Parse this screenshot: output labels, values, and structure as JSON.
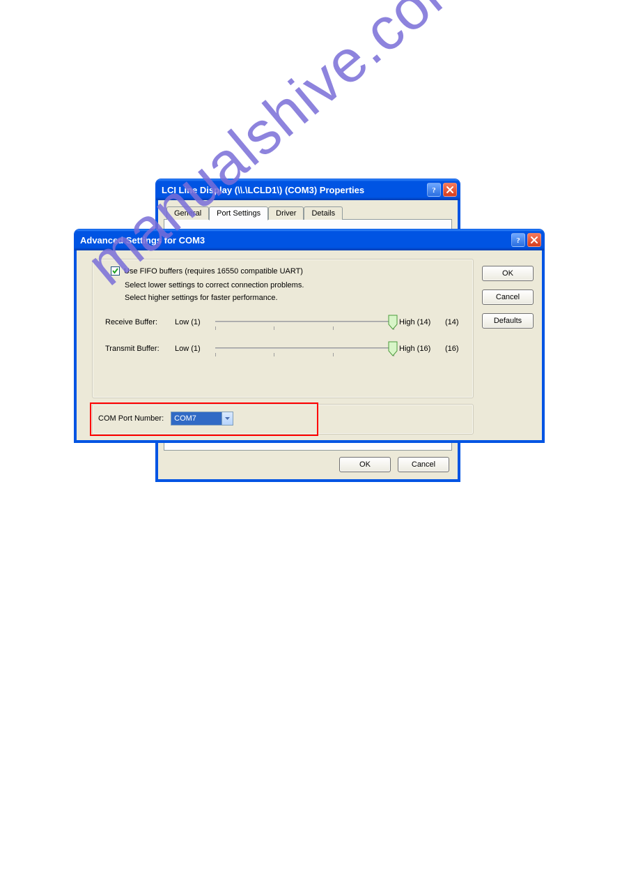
{
  "watermark": "manualshive.com",
  "parent": {
    "title": "LCI Line Display (\\\\.\\LCLD1\\) (COM3) Properties",
    "tabs": {
      "items": [
        {
          "label": "General"
        },
        {
          "label": "Port Settings"
        },
        {
          "label": "Driver"
        },
        {
          "label": "Details"
        }
      ]
    },
    "footer": {
      "ok": "OK",
      "cancel": "Cancel"
    }
  },
  "child": {
    "title": "Advanced Settings for COM3",
    "fifo": {
      "checkbox_label": "Use FIFO buffers (requires 16550 compatible UART)",
      "hint1": "Select lower settings to correct connection problems.",
      "hint2": "Select higher settings for faster performance."
    },
    "sliders": {
      "receive": {
        "label": "Receive Buffer:",
        "low": "Low (1)",
        "high": "High (14)",
        "value": "(14)"
      },
      "transmit": {
        "label": "Transmit Buffer:",
        "low": "Low (1)",
        "high": "High (16)",
        "value": "(16)"
      }
    },
    "port": {
      "label": "COM Port Number:",
      "selected": "COM7"
    },
    "buttons": {
      "ok": "OK",
      "cancel": "Cancel",
      "defaults": "Defaults"
    }
  }
}
